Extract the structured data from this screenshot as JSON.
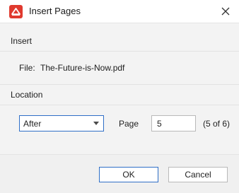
{
  "window": {
    "title": "Insert Pages",
    "icon": "pdf-app-icon",
    "close_icon": "close-icon"
  },
  "insert_section": {
    "header": "Insert",
    "file_label": "File:",
    "file_name": "The-Future-is-Now.pdf"
  },
  "location_section": {
    "header": "Location",
    "position_select": {
      "selected": "After"
    },
    "page_label": "Page",
    "page_value": "5",
    "page_count": "(5 of 6)"
  },
  "footer": {
    "ok_label": "OK",
    "cancel_label": "Cancel"
  },
  "colors": {
    "accent": "#2f6fc7",
    "app_icon_red": "#e03a2f"
  }
}
